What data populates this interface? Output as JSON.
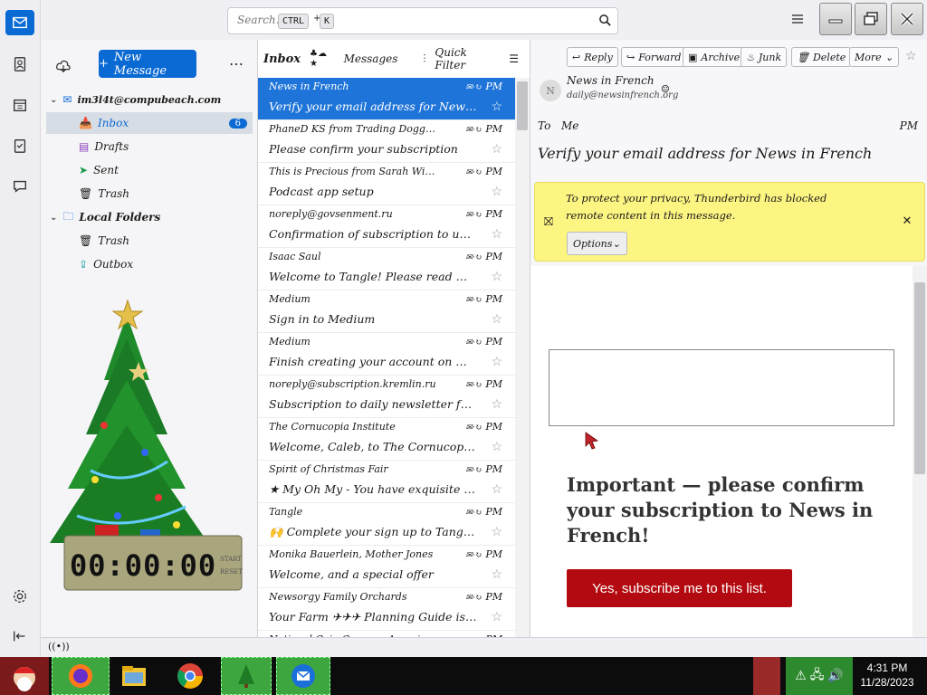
{
  "colors": {
    "accent": "#0a6ad4",
    "selection": "#1e74d8",
    "notice": "#fdf582",
    "cta": "#b20a10"
  },
  "topbar": {
    "search_placeholder": "Search…",
    "kbd_ctrl": "CTRL",
    "kbd_k": "K"
  },
  "folderpane": {
    "new_message": "New Message",
    "account": "im3l4t@compubeach.com",
    "folders": [
      {
        "label": "Inbox",
        "icon": "inbox-icon",
        "badge": "6"
      },
      {
        "label": "Drafts",
        "icon": "drafts-icon"
      },
      {
        "label": "Sent",
        "icon": "sent-icon"
      },
      {
        "label": "Trash",
        "icon": "trash-icon"
      }
    ],
    "local_label": "Local Folders",
    "local_folders": [
      {
        "label": "Trash",
        "icon": "trash-icon"
      },
      {
        "label": "Outbox",
        "icon": "outbox-icon"
      }
    ],
    "clock": "00:00:00",
    "clock_labels": [
      "START",
      "RESET"
    ]
  },
  "msglist": {
    "folder": "Inbox",
    "messages_label": "Messages",
    "quick_filter": "Quick Filter",
    "rows": [
      {
        "from": "News in French",
        "time": "PM",
        "subject": "Verify your email address for News in French",
        "selected": true
      },
      {
        "from": "PhaneD KS from Trading Doggy Style",
        "time": "PM",
        "subject": "Please confirm your subscription"
      },
      {
        "from": "This is Precious from Sarah Wilson",
        "time": "PM",
        "subject": "Podcast app setup"
      },
      {
        "from": "noreply@govsenment.ru",
        "time": "PM",
        "subject": "Confirmation of subscription to updates from the …"
      },
      {
        "from": "Isaac Saul",
        "time": "PM",
        "subject": "Welcome to Tangle! Please read me :)"
      },
      {
        "from": "Medium",
        "time": "PM",
        "subject": "Sign in to Medium"
      },
      {
        "from": "Medium",
        "time": "PM",
        "subject": "Finish creating your account on Medium"
      },
      {
        "from": "noreply@subscription.kremlin.ru",
        "time": "PM",
        "subject": "Subscription to daily newsletter from kremlin.ru"
      },
      {
        "from": "The Cornucopia Institute",
        "time": "PM",
        "subject": "Welcome, Caleb, to The Cornucopia Institute"
      },
      {
        "from": "Spirit of Christmas Fair",
        "time": "PM",
        "subject": "My Oh My - You have exquisite taste!",
        "prefix": "★"
      },
      {
        "from": "Tangle",
        "time": "PM",
        "subject": "Complete your sign up to Tangle!",
        "prefix": "🙌"
      },
      {
        "from": "Monika Bauerlein, Mother Jones",
        "time": "PM",
        "subject": "Welcome, and a special offer"
      },
      {
        "from": "Newsorgy Family Orchards",
        "time": "PM",
        "subject": "Your Farm ✈︎✈︎✈︎ Planning Guide is ready…"
      },
      {
        "from": "National Coin Growers Association",
        "time": "PM",
        "subject": ""
      }
    ]
  },
  "reader": {
    "toolbar": {
      "reply": "Reply",
      "forward": "Forward",
      "archive": "Archive",
      "junk": "Junk",
      "delete": "Delete",
      "more": "More"
    },
    "from_name": "News in French",
    "from_email": "daily@newsinfrench.org",
    "to_label": "To",
    "to_value": "Me",
    "time": "PM",
    "subject": "Verify your email address for News in French",
    "notice_text": "To protect your privacy, Thunderbird has blocked remote content in this message.",
    "options": "Options",
    "heading": "Important — please confirm your subscription to News in French!",
    "cta": "Yes, subscribe me to this list."
  },
  "taskbar": {
    "time": "4:31 PM",
    "date": "11/28/2023"
  }
}
